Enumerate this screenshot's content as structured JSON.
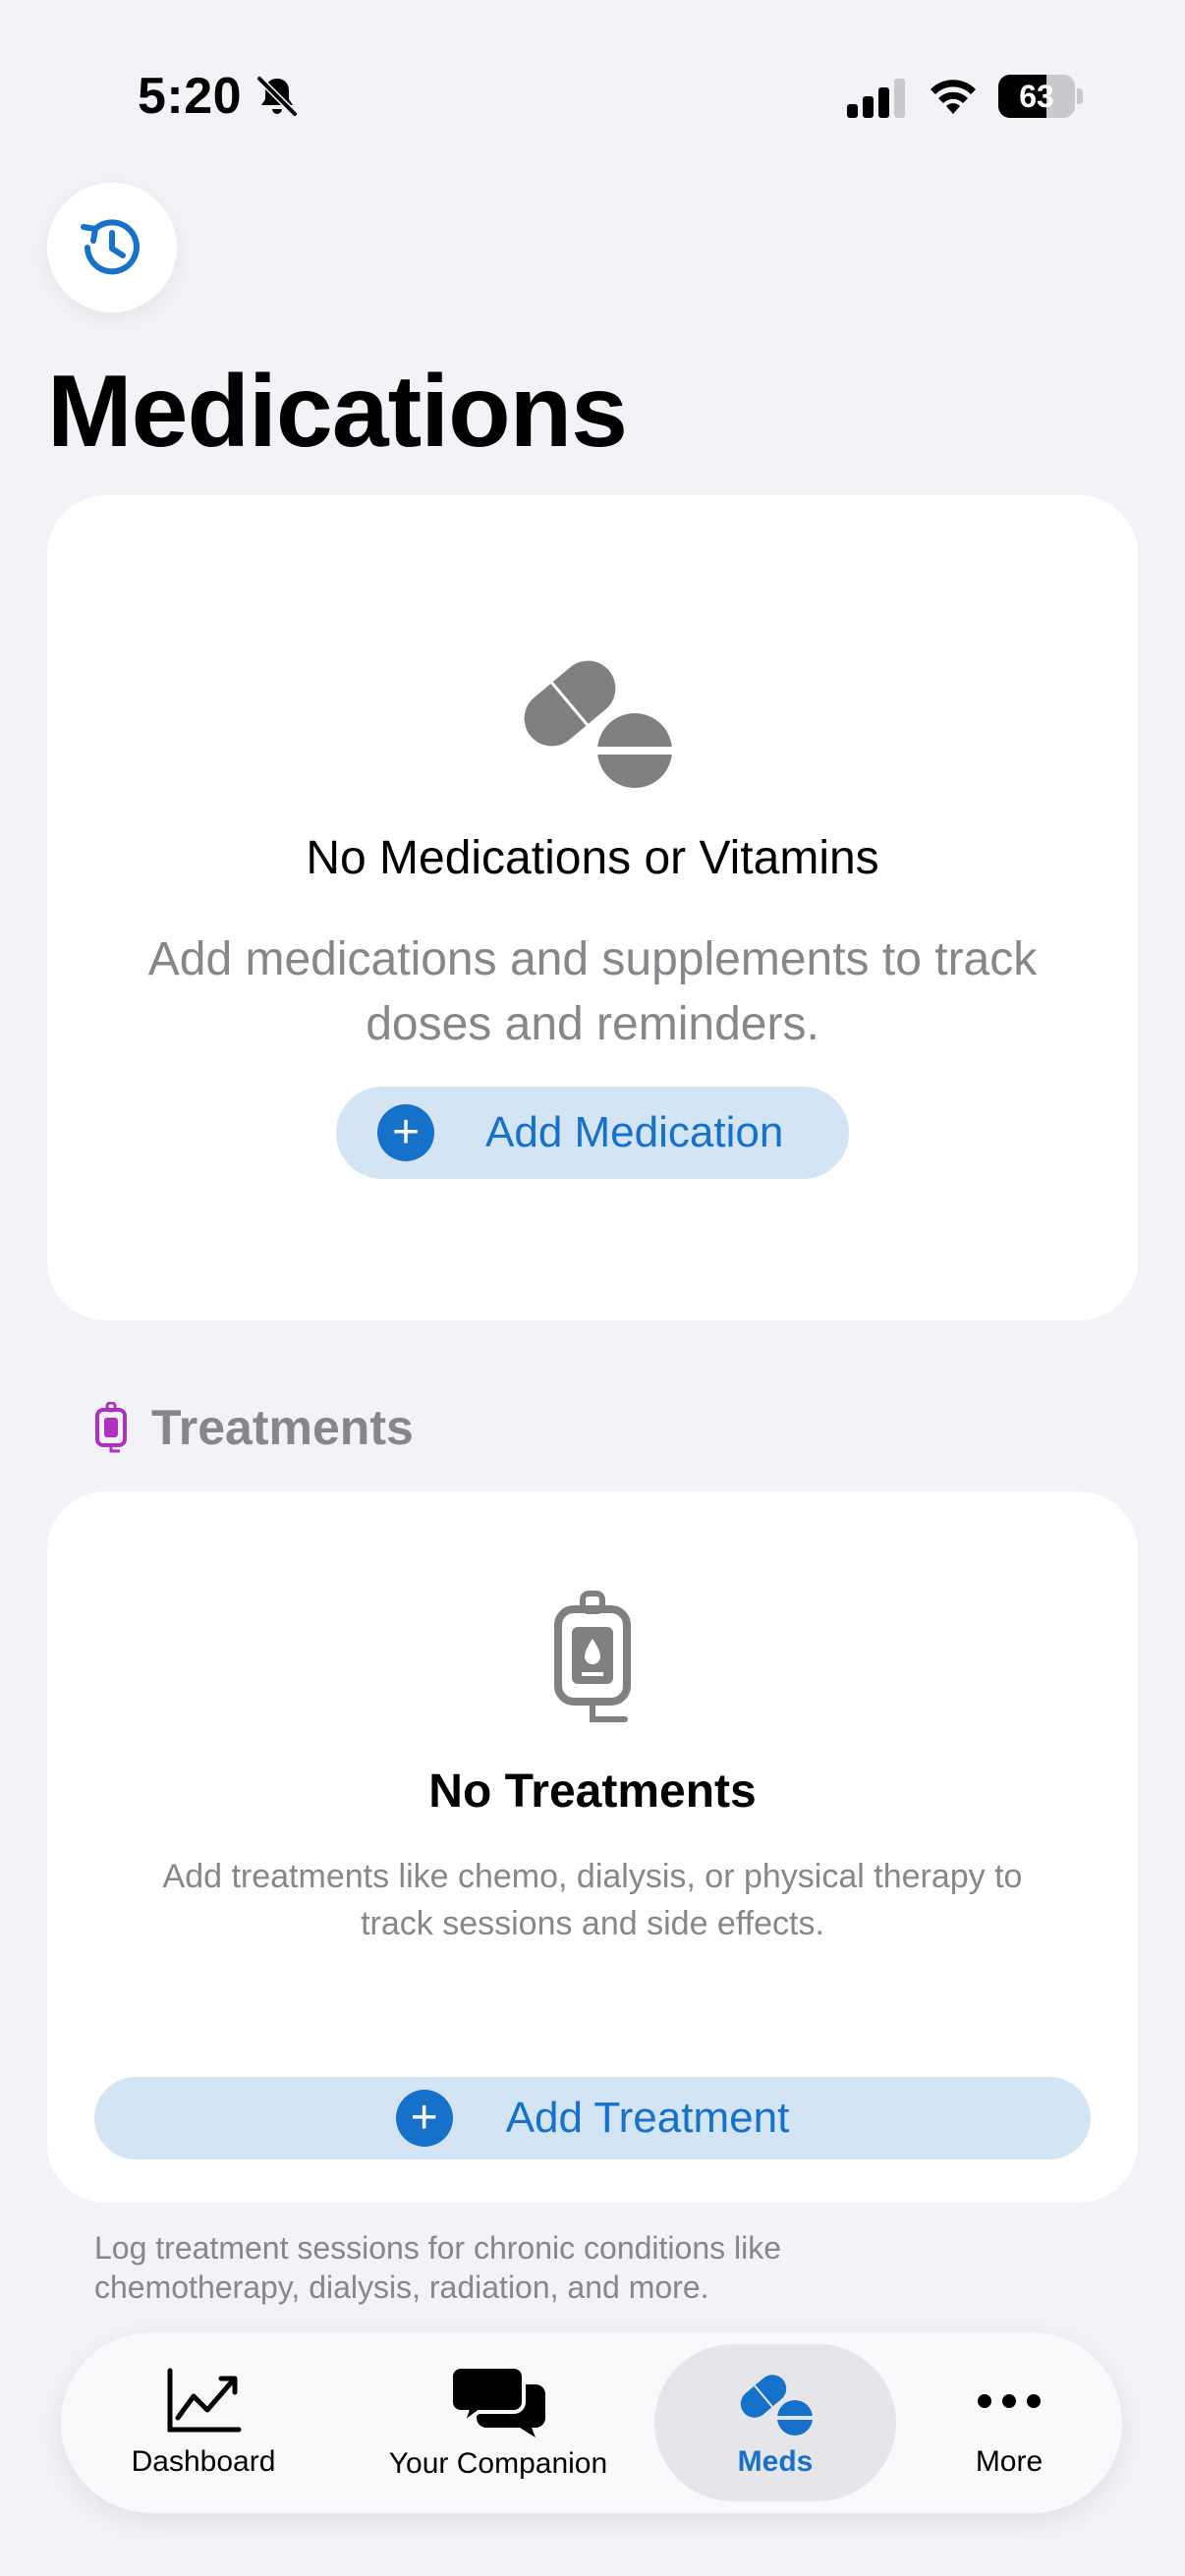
{
  "status": {
    "time": "5:20",
    "battery": "63",
    "battery_level": 0.63
  },
  "page": {
    "title": "Medications"
  },
  "medications_card": {
    "title": "No Medications or Vitamins",
    "subtitle_line1": "Add medications and supplements to track",
    "subtitle_line2": "doses and reminders.",
    "button_label": "Add Medication",
    "icon": "pills-icon"
  },
  "treatments_section": {
    "label": "Treatments",
    "icon": "iv-bag-icon"
  },
  "treatments_card": {
    "title": "No Treatments",
    "subtitle_line1": "Add treatments like chemo, dialysis, or physical therapy to",
    "subtitle_line2": "track sessions and side effects.",
    "button_label": "Add Treatment"
  },
  "footer_note": {
    "line1": "Log treatment sessions for chronic conditions like",
    "line2": "chemotherapy, dialysis, radiation, and more."
  },
  "tabbar": {
    "tabs": [
      {
        "label": "Dashboard",
        "icon": "chart-line-icon"
      },
      {
        "label": "Your Companion",
        "icon": "chat-bubbles-icon"
      },
      {
        "label": "Meds",
        "icon": "pills-icon",
        "active": true
      },
      {
        "label": "More",
        "icon": "ellipsis-icon"
      }
    ]
  },
  "colors": {
    "accent": "#1571c9",
    "pill_bg": "#d3e4f5",
    "background": "#f2f2f7",
    "muted_text": "#86868b",
    "treatment_icon": "#b030c0"
  }
}
